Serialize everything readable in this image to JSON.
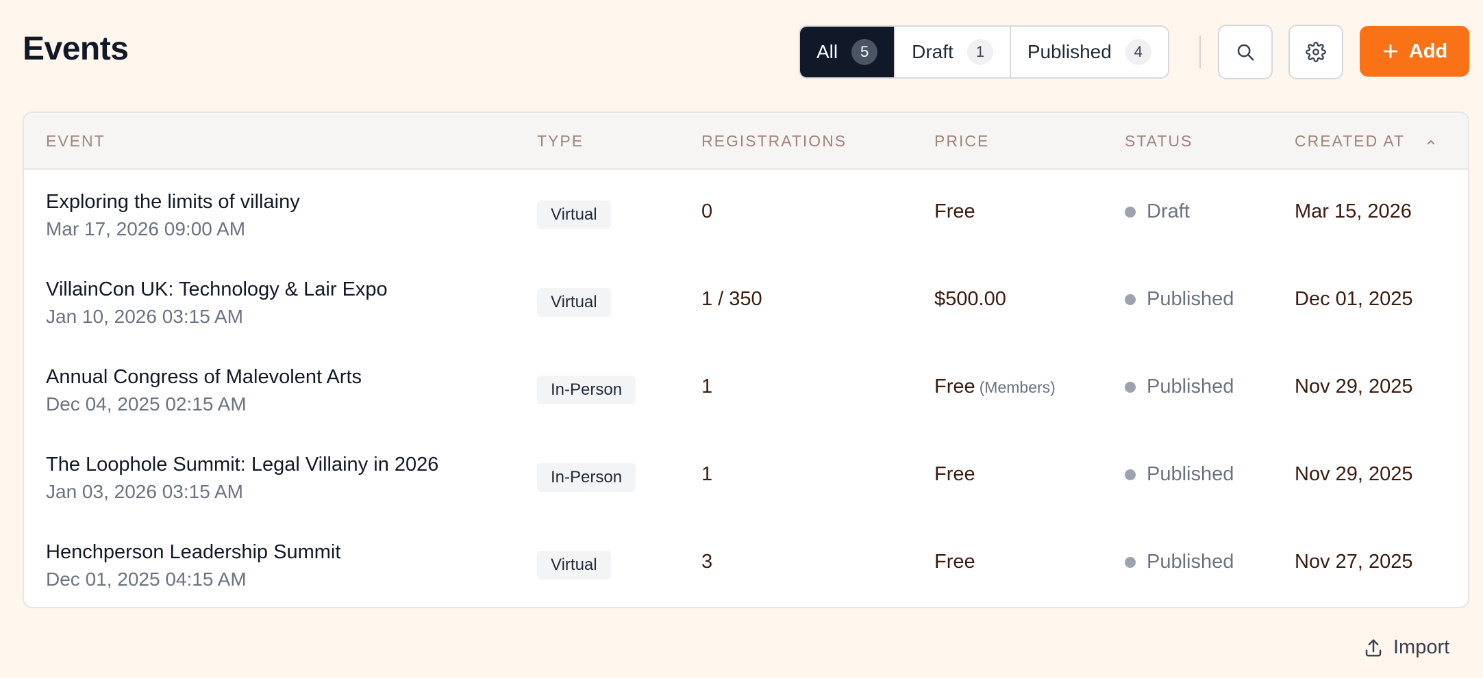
{
  "page_title": "Events",
  "filters": [
    {
      "label": "All",
      "count": "5"
    },
    {
      "label": "Draft",
      "count": "1"
    },
    {
      "label": "Published",
      "count": "4"
    }
  ],
  "toolbar": {
    "search_icon": "search-icon",
    "settings_icon": "gear-icon",
    "add_label": "Add"
  },
  "table": {
    "columns": [
      "Event",
      "Type",
      "Registrations",
      "Price",
      "Status",
      "Created At"
    ],
    "rows": [
      {
        "name": "Exploring the limits of villainy",
        "date": "Mar 17, 2026 09:00 AM",
        "type": "Virtual",
        "registrations": "0",
        "price": "Free",
        "price_note": "",
        "status": "Draft",
        "created": "Mar 15, 2026"
      },
      {
        "name": "VillainCon UK: Technology & Lair Expo",
        "date": "Jan 10, 2026 03:15 AM",
        "type": "Virtual",
        "registrations": "1 / 350",
        "price": "$500.00",
        "price_note": "",
        "status": "Published",
        "created": "Dec 01, 2025"
      },
      {
        "name": "Annual Congress of Malevolent Arts",
        "date": "Dec 04, 2025 02:15 AM",
        "type": "In-Person",
        "registrations": "1",
        "price": "Free",
        "price_note": "(Members)",
        "status": "Published",
        "created": "Nov 29, 2025"
      },
      {
        "name": "The Loophole Summit: Legal Villainy in 2026",
        "date": "Jan 03, 2026 03:15 AM",
        "type": "In-Person",
        "registrations": "1",
        "price": "Free",
        "price_note": "",
        "status": "Published",
        "created": "Nov 29, 2025"
      },
      {
        "name": "Henchperson Leadership Summit",
        "date": "Dec 01, 2025 04:15 AM",
        "type": "Virtual",
        "registrations": "3",
        "price": "Free",
        "price_note": "",
        "status": "Published",
        "created": "Nov 27, 2025"
      }
    ]
  },
  "footer": {
    "import_label": "Import"
  },
  "colors": {
    "accent": "#f97316",
    "active_filter": "#111827",
    "background": "#fff6ed"
  }
}
